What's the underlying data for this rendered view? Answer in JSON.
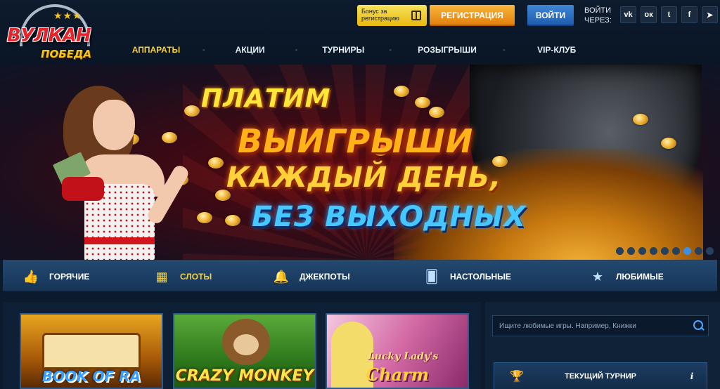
{
  "header": {
    "logo": {
      "top_text": "ВУЛКАН",
      "bottom_text": "ПОБЕДА"
    },
    "bonus_badge": "Бонус за регистрацию",
    "register_label": "РЕГИСТРАЦИЯ",
    "login_label": "ВОЙТИ",
    "login_via": "ВОЙТИ ЧЕРЕЗ:",
    "socials": [
      {
        "name": "vk-icon",
        "glyph": "vk"
      },
      {
        "name": "odnoklassniki-icon",
        "glyph": "ок"
      },
      {
        "name": "twitter-icon",
        "glyph": "t"
      },
      {
        "name": "facebook-icon",
        "glyph": "f"
      },
      {
        "name": "telegram-icon",
        "glyph": "➤"
      }
    ]
  },
  "nav": {
    "items": [
      {
        "label": "АППАРАТЫ",
        "active": true
      },
      {
        "label": "АКЦИИ",
        "active": false
      },
      {
        "label": "ТУРНИРЫ",
        "active": false
      },
      {
        "label": "РОЗЫГРЫШИ",
        "active": false
      },
      {
        "label": "VIP-КЛУБ",
        "active": false
      }
    ],
    "separator": "-"
  },
  "banner": {
    "line1": "ПЛАТИМ",
    "line2": "ВЫИГРЫШИ",
    "line3": "КАЖДЫЙ ДЕНЬ,",
    "line4": "БЕЗ ВЫХОДНЫХ",
    "slide_count": 9,
    "active_slide": 7
  },
  "categories": [
    {
      "label": "ГОРЯЧИЕ",
      "icon": "hot-icon",
      "active": false
    },
    {
      "label": "СЛОТЫ",
      "icon": "slot-machine-icon",
      "active": true
    },
    {
      "label": "ДЖЕКПОТЫ",
      "icon": "bell-icon",
      "active": false
    },
    {
      "label": "НАСТОЛЬНЫЕ",
      "icon": "card-icon",
      "active": false
    },
    {
      "label": "ЛЮБИМЫЕ",
      "icon": "star-icon",
      "active": false
    }
  ],
  "games": [
    {
      "title": "BOOK OF RA"
    },
    {
      "title": "CRAZY MONKEY"
    },
    {
      "title": "Charm",
      "subtitle": "Lucky Lady's"
    }
  ],
  "search": {
    "placeholder": "Ищите любимые игры. Например, Книжки"
  },
  "tournament": {
    "label": "ТЕКУЩИЙ ТУРНИР",
    "info": "i"
  },
  "colors": {
    "accent_yellow": "#f4d03f",
    "register_orange": "#f0981e",
    "login_blue": "#2a70c4",
    "background": "#0b1a2c"
  }
}
